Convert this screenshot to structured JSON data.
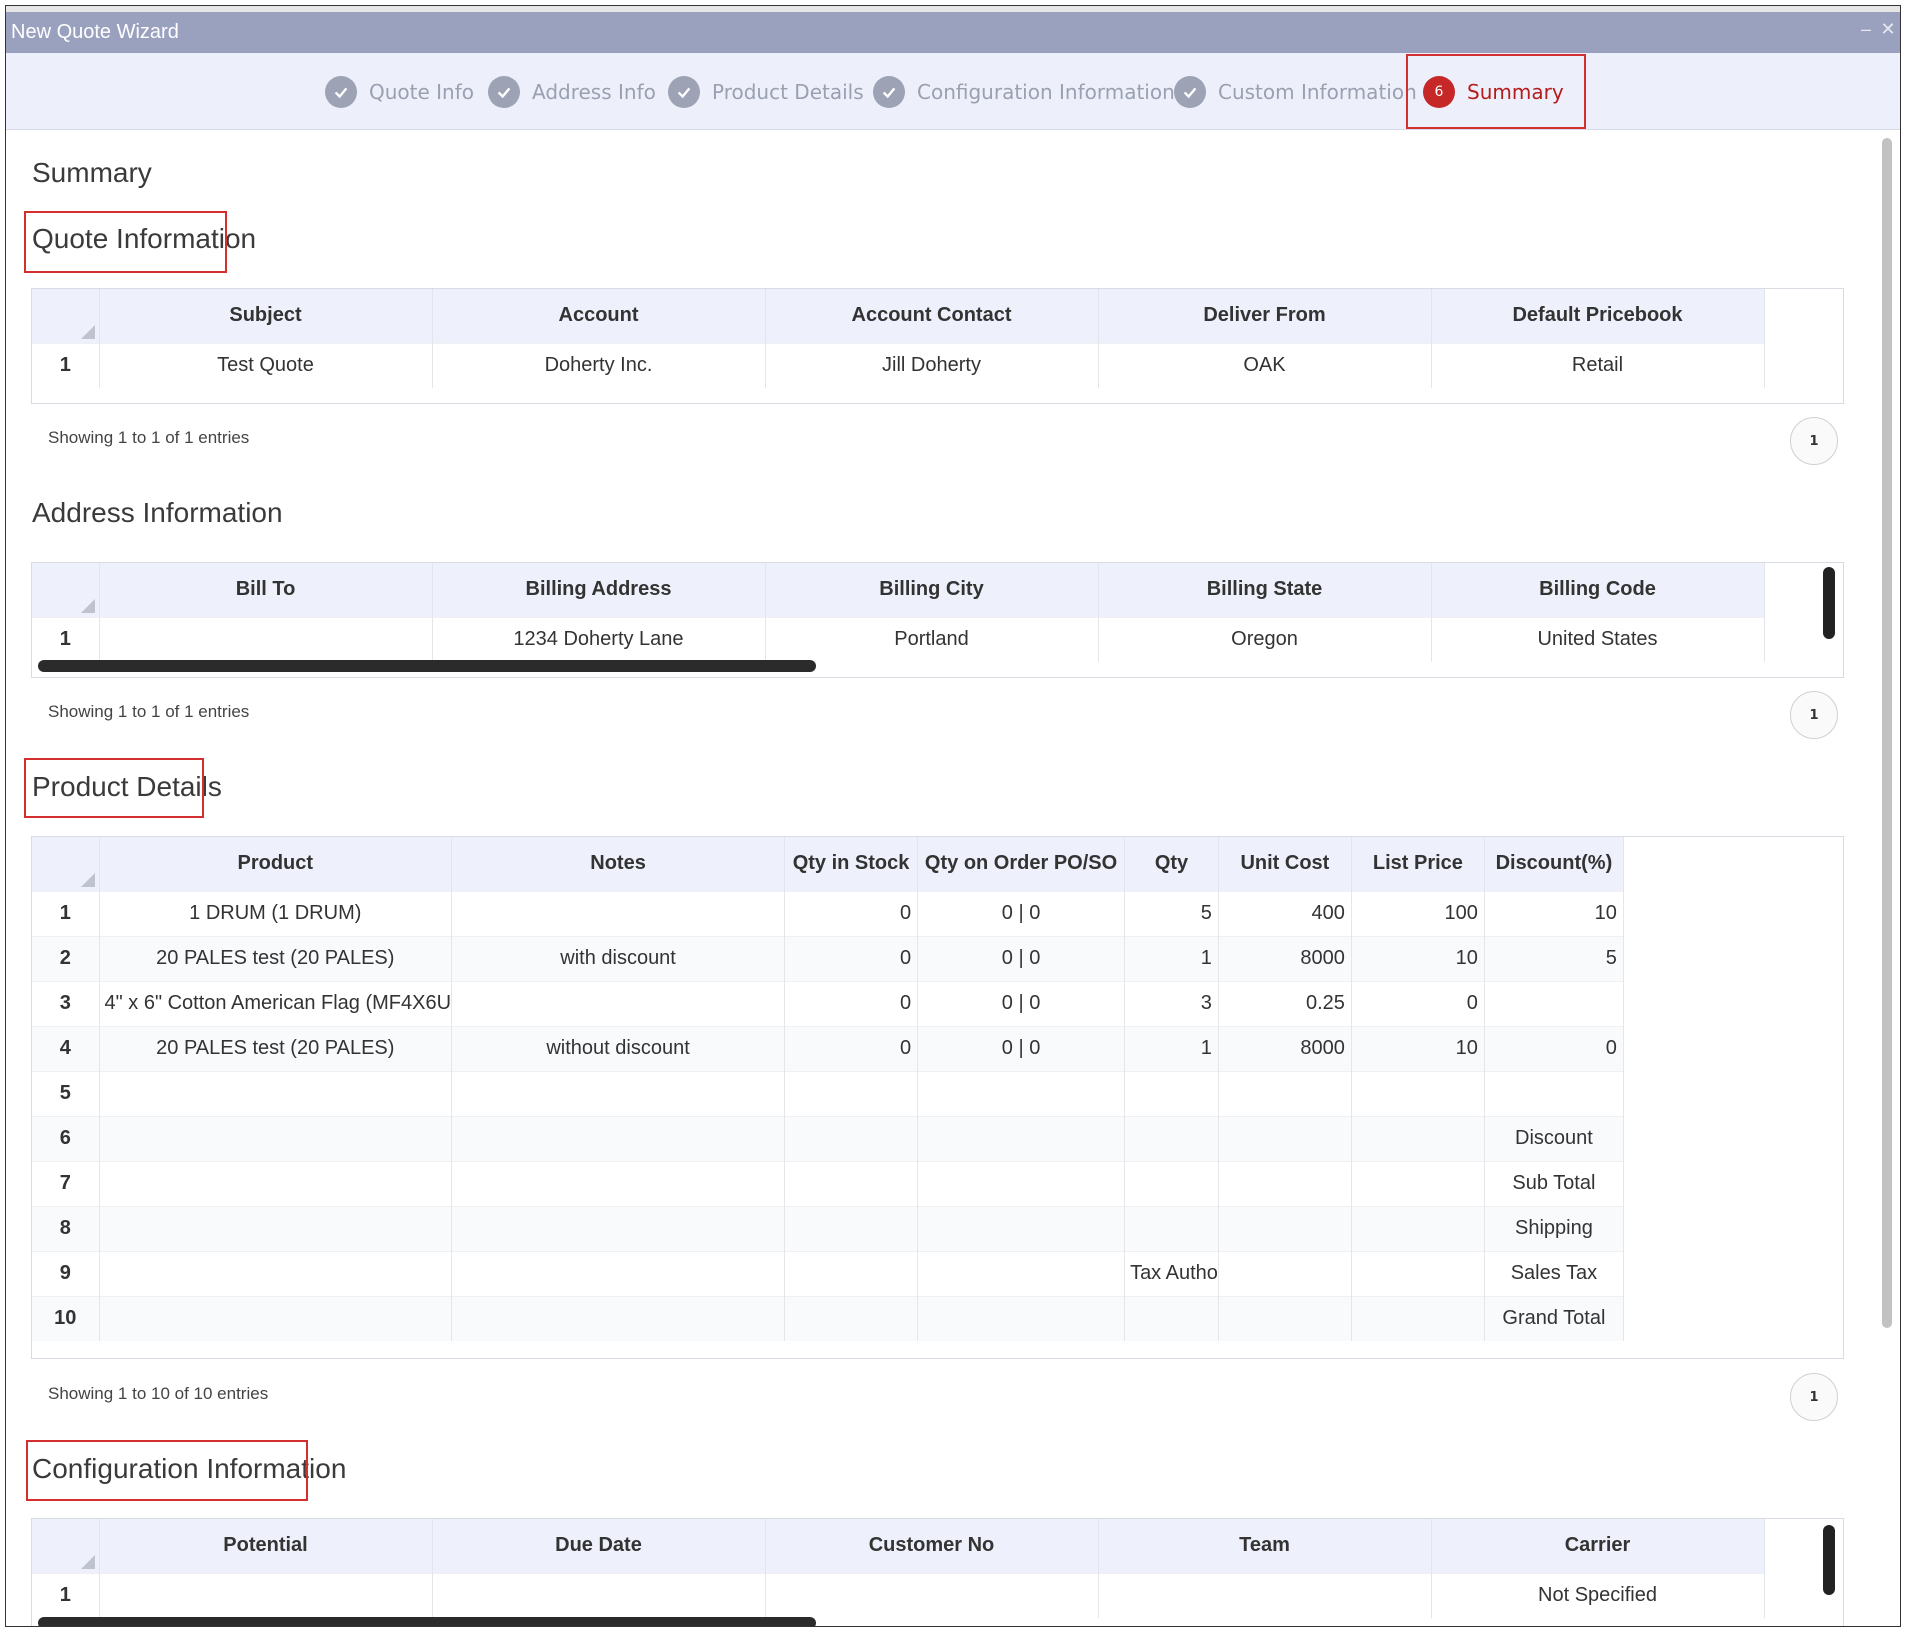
{
  "window": {
    "title": "New Quote Wizard",
    "minimize_icon": "minimize-icon",
    "close_icon": "close-icon"
  },
  "steps": [
    {
      "label": "Quote Info",
      "state": "done"
    },
    {
      "label": "Address Info",
      "state": "done"
    },
    {
      "label": "Product Details",
      "state": "done"
    },
    {
      "label": "Configuration Information",
      "state": "done"
    },
    {
      "label": "Custom Information",
      "state": "done"
    },
    {
      "label": "Summary",
      "number": "6",
      "state": "active"
    }
  ],
  "page_title": "Summary",
  "quote": {
    "heading": "Quote Information",
    "columns": [
      "Subject",
      "Account",
      "Account Contact",
      "Deliver From",
      "Default Pricebook"
    ],
    "rows": [
      {
        "n": "1",
        "cells": [
          "Test Quote",
          "Doherty Inc.",
          "Jill Doherty",
          "OAK",
          "Retail"
        ]
      }
    ],
    "showing": "Showing 1 to 1 of 1 entries",
    "page": "1"
  },
  "address": {
    "heading": "Address Information",
    "columns": [
      "Bill To",
      "Billing Address",
      "Billing City",
      "Billing State",
      "Billing Code"
    ],
    "rows": [
      {
        "n": "1",
        "cells": [
          "",
          "1234 Doherty Lane",
          "Portland",
          "Oregon",
          "United States"
        ]
      }
    ],
    "showing": "Showing 1 to 1 of 1 entries",
    "page": "1"
  },
  "products": {
    "heading": "Product Details",
    "columns": [
      "Product",
      "Notes",
      "Qty in Stock",
      "Qty on Order PO/SO",
      "Qty",
      "Unit Cost",
      "List Price",
      "Discount(%)"
    ],
    "rows": [
      {
        "n": "1",
        "cells": [
          "1 DRUM (1 DRUM)",
          "",
          "0",
          "0 | 0",
          "5",
          "400",
          "100",
          "10"
        ]
      },
      {
        "n": "2",
        "cells": [
          "20 PALES test (20 PALES)",
          "with discount",
          "0",
          "0 | 0",
          "1",
          "8000",
          "10",
          "5"
        ]
      },
      {
        "n": "3",
        "cells": [
          "4\" x 6\" Cotton American Flag (MF4X6U",
          "",
          "0",
          "0 | 0",
          "3",
          "0.25",
          "0",
          ""
        ]
      },
      {
        "n": "4",
        "cells": [
          "20 PALES test (20 PALES)",
          "without discount",
          "0",
          "0 | 0",
          "1",
          "8000",
          "10",
          "0"
        ]
      },
      {
        "n": "5",
        "cells": [
          "",
          "",
          "",
          "",
          "",
          "",
          "",
          ""
        ]
      },
      {
        "n": "6",
        "cells": [
          "",
          "",
          "",
          "",
          "",
          "",
          "",
          "Discount"
        ]
      },
      {
        "n": "7",
        "cells": [
          "",
          "",
          "",
          "",
          "",
          "",
          "",
          "Sub Total"
        ]
      },
      {
        "n": "8",
        "cells": [
          "",
          "",
          "",
          "",
          "",
          "",
          "",
          "Shipping"
        ]
      },
      {
        "n": "9",
        "cells": [
          "",
          "",
          "",
          "",
          "Tax Autho",
          "",
          "",
          "Sales Tax"
        ]
      },
      {
        "n": "10",
        "cells": [
          "",
          "",
          "",
          "",
          "",
          "",
          "",
          "Grand Total"
        ]
      }
    ],
    "showing": "Showing 1 to 10 of 10 entries",
    "page": "1"
  },
  "config": {
    "heading": "Configuration Information",
    "columns": [
      "Potential",
      "Due Date",
      "Customer No",
      "Team",
      "Carrier"
    ],
    "rows": [
      {
        "n": "1",
        "cells": [
          "",
          "",
          "",
          "",
          "Not Specified"
        ]
      }
    ]
  }
}
